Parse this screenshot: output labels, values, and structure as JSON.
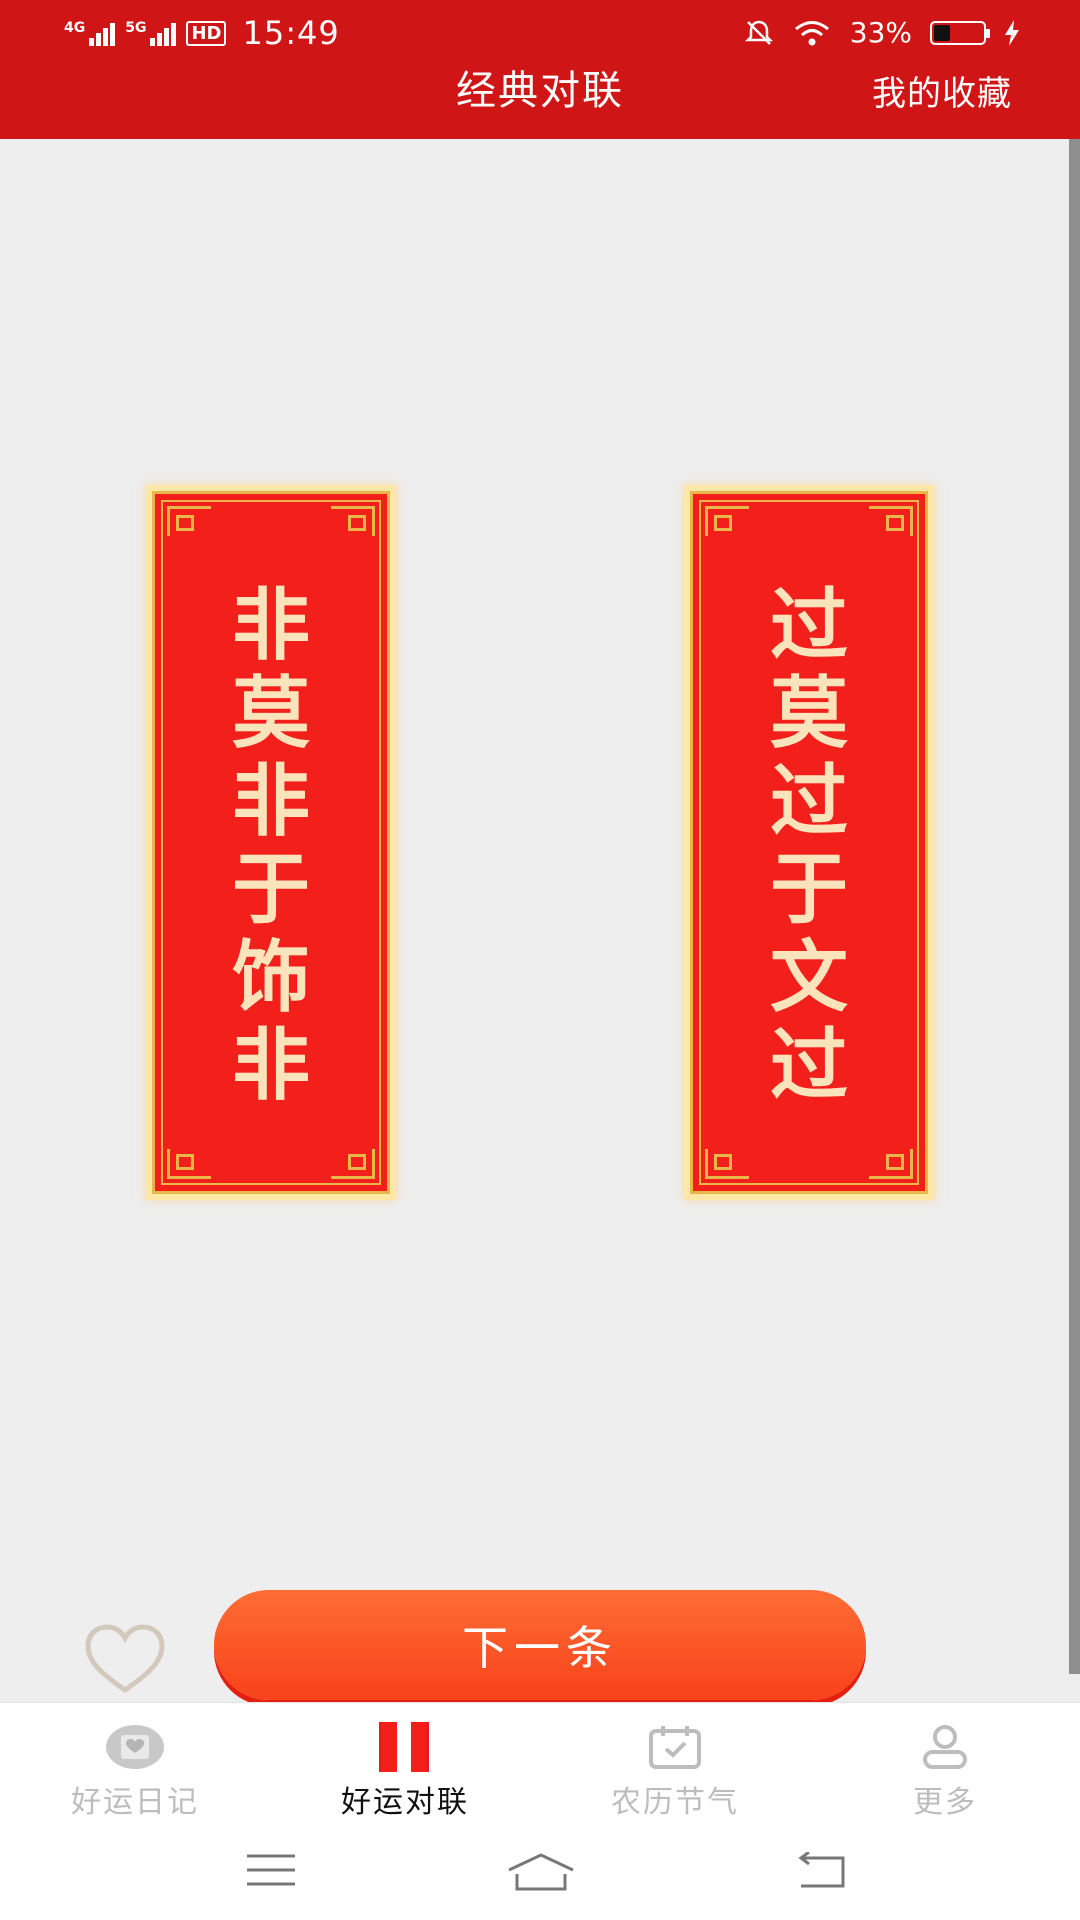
{
  "status_bar": {
    "network_1": "4G",
    "network_2": "5G",
    "hd_badge": "HD",
    "time": "15:49",
    "battery_text": "33%",
    "battery_level": 0.33
  },
  "header": {
    "title": "经典对联",
    "favorites_label": "我的收藏"
  },
  "couplet": {
    "left_chars": [
      "非",
      "莫",
      "非",
      "于",
      "饰",
      "非"
    ],
    "right_chars": [
      "过",
      "莫",
      "过",
      "于",
      "文",
      "过"
    ]
  },
  "actions": {
    "next_label": "下一条"
  },
  "tabs": [
    {
      "label": "好运日记",
      "icon": "diary-icon",
      "active": false
    },
    {
      "label": "好运对联",
      "icon": "couplet-icon",
      "active": true
    },
    {
      "label": "农历节气",
      "icon": "calendar-icon",
      "active": false
    },
    {
      "label": "更多",
      "icon": "profile-icon",
      "active": false
    }
  ],
  "colors": {
    "header_red": "#cf1515",
    "scroll_red": "#f21f1a",
    "scroll_gold": "#e9b64b",
    "button_orange": "#f8421a"
  }
}
